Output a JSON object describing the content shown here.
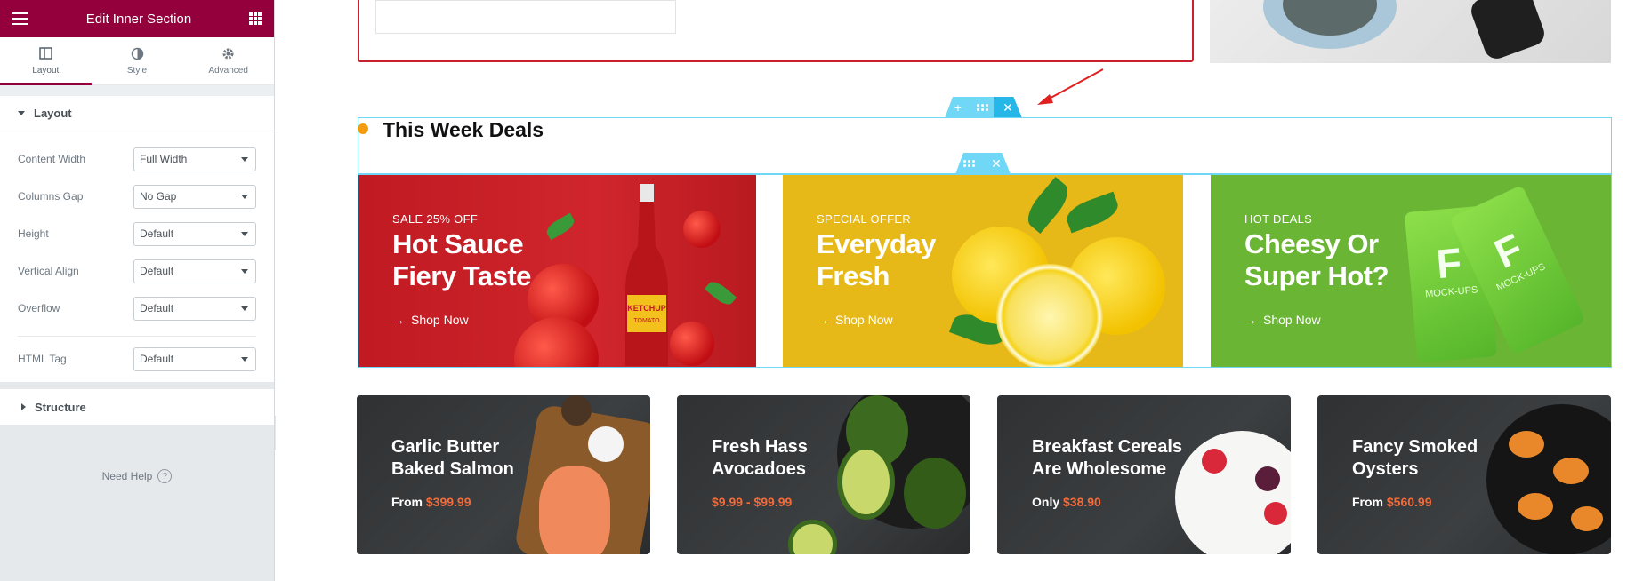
{
  "panel": {
    "title": "Edit Inner Section",
    "tabs": [
      {
        "label": "Layout",
        "icon": "layout-icon"
      },
      {
        "label": "Style",
        "icon": "contrast-icon"
      },
      {
        "label": "Advanced",
        "icon": "gear-icon"
      }
    ],
    "section_layout": "Layout",
    "controls": [
      {
        "label": "Content Width",
        "value": "Full Width"
      },
      {
        "label": "Columns Gap",
        "value": "No Gap"
      },
      {
        "label": "Height",
        "value": "Default"
      },
      {
        "label": "Vertical Align",
        "value": "Default"
      },
      {
        "label": "Overflow",
        "value": "Default"
      }
    ],
    "html_tag": {
      "label": "HTML Tag",
      "value": "Default"
    },
    "section_structure": "Structure",
    "need_help": "Need Help",
    "help_icon_glyph": "?",
    "accent": "#93003c"
  },
  "canvas": {
    "heading": "This Week Deals",
    "toolbar_add": "+",
    "toolbar_close": "✕",
    "banners": [
      {
        "small": "SALE 25% OFF",
        "line1": "Hot Sauce",
        "line2": "Fiery Taste",
        "cta": "Shop Now",
        "color": "#c8202d"
      },
      {
        "small": "SPECIAL OFFER",
        "line1": "Everyday",
        "line2": "Fresh",
        "cta": "Shop Now",
        "color": "#e6b818"
      },
      {
        "small": "HOT DEALS",
        "line1": "Cheesy Or",
        "line2": "Super Hot?",
        "cta": "Shop Now",
        "color": "#6ab534"
      }
    ],
    "ketchup_label": "KETCHUP",
    "tomato_label": "TOMATO",
    "pack_label": "MOCK-UPS",
    "cards": [
      {
        "line1": "Garlic Butter",
        "line2": "Baked Salmon",
        "prefix": "From ",
        "price": "$399.99"
      },
      {
        "line1": "Fresh Hass",
        "line2": "Avocadoes",
        "prefix": "",
        "price": "$9.99 - $99.99"
      },
      {
        "line1": "Breakfast Cereals",
        "line2": "Are Wholesome",
        "prefix": "Only ",
        "price": "$38.90"
      },
      {
        "line1": "Fancy Smoked",
        "line2": "Oysters",
        "prefix": "From ",
        "price": "$560.99"
      }
    ]
  }
}
